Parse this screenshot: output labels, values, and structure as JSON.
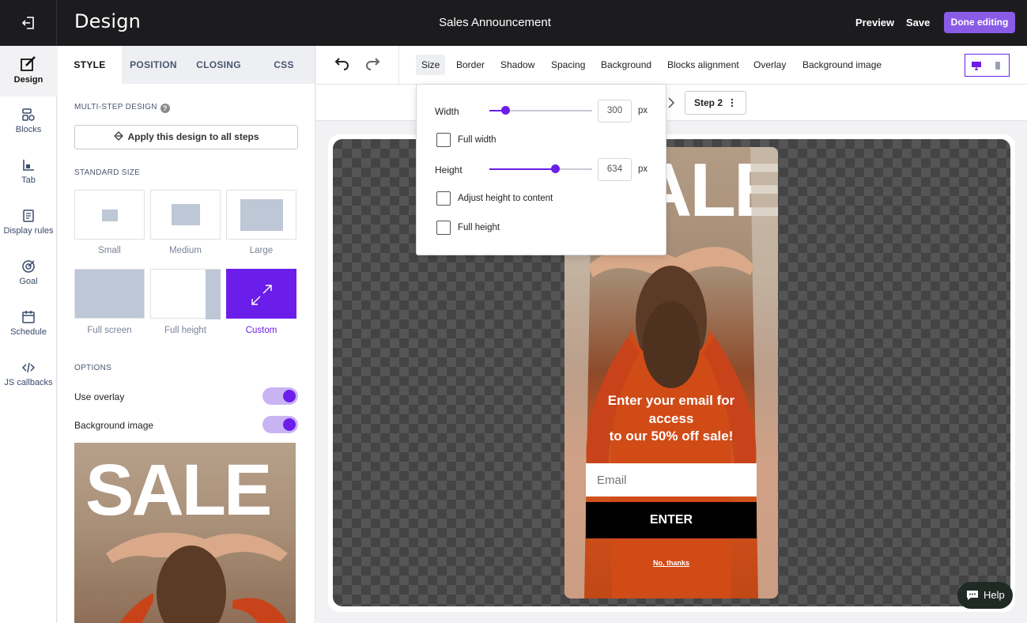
{
  "topbar": {
    "app_title": "Design",
    "document_title": "Sales Announcement",
    "preview_label": "Preview",
    "save_label": "Save",
    "done_label": "Done editing"
  },
  "rail": {
    "items": [
      {
        "label": "Design",
        "icon": "brush-icon"
      },
      {
        "label": "Blocks",
        "icon": "blocks-icon"
      },
      {
        "label": "Tab",
        "icon": "tab-icon"
      },
      {
        "label": "Display rules",
        "icon": "document-icon"
      },
      {
        "label": "Goal",
        "icon": "target-icon"
      },
      {
        "label": "Schedule",
        "icon": "calendar-icon"
      },
      {
        "label": "JS callbacks",
        "icon": "code-icon"
      }
    ]
  },
  "panel": {
    "tabs": [
      "STYLE",
      "POSITION",
      "CLOSING",
      "CSS"
    ],
    "multi_step_label": "MULTI-STEP DESIGN",
    "help_glyph": "?",
    "apply_button": "Apply this design to all steps",
    "standard_size_label": "STANDARD SIZE",
    "sizes": [
      "Small",
      "Medium",
      "Large",
      "Full screen",
      "Full height",
      "Custom"
    ],
    "selected_size": "Custom",
    "options_label": "OPTIONS",
    "use_overlay_label": "Use overlay",
    "use_overlay_on": true,
    "background_image_label": "Background image",
    "background_image_on": true,
    "preview_sale_text": "SALE"
  },
  "toolbar": {
    "items": [
      "Size",
      "Border",
      "Shadow",
      "Spacing",
      "Background",
      "Blocks alignment",
      "Overlay",
      "Background image"
    ],
    "active_item": "Size"
  },
  "subbar": {
    "step_label": "Step 2"
  },
  "size_popover": {
    "width_label": "Width",
    "width_value": "300",
    "width_fraction": 0.15,
    "width_unit": "px",
    "full_width_label": "Full width",
    "height_label": "Height",
    "height_value": "634",
    "height_fraction": 0.64,
    "height_unit": "px",
    "adjust_height_label": "Adjust height to content",
    "full_height_label": "Full height"
  },
  "popup": {
    "sale_text": "ALE",
    "headline_line1": "Enter your email for",
    "headline_line2": "access",
    "headline_line3": "to our 50% off sale!",
    "email_placeholder": "Email",
    "enter_label": "ENTER",
    "no_thanks_label": "No, thanks"
  },
  "help_button": {
    "label": "Help"
  },
  "colors": {
    "accent": "#6b1eea",
    "done_button": "#8a5ce6",
    "topbar": "#1c1c1f"
  }
}
